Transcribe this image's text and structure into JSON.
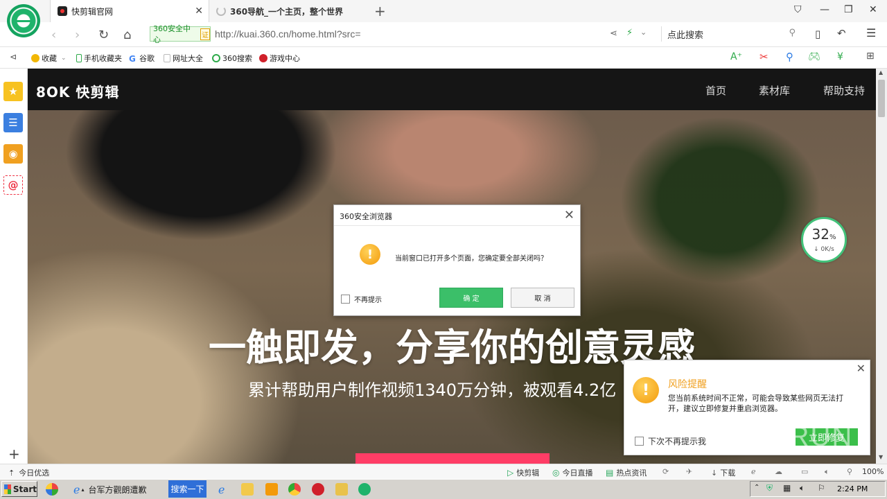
{
  "browser": {
    "active_tab": "快剪辑官网",
    "inactive_tab": "360导航_一个主页，整个世界",
    "safe_badge": "360安全中心",
    "safe_cert": "证",
    "url": "http://kuai.360.cn/home.html?src=",
    "search_placeholder": "点此搜索"
  },
  "bookmarks": [
    {
      "label": "收藏",
      "color": "#f2b705"
    },
    {
      "label": "手机收藏夹",
      "color": "#2eaa4a"
    },
    {
      "label": "谷歌",
      "color": "#4285f4"
    },
    {
      "label": "网址大全",
      "color": "#bbbbbb"
    },
    {
      "label": "360搜索",
      "color": "#2eaa4a"
    },
    {
      "label": "游戏中心",
      "color": "#d0202a"
    }
  ],
  "site": {
    "logo": "8OK 快剪辑",
    "nav": [
      "首页",
      "素材库",
      "帮助支持"
    ],
    "hero_title": "一触即发，分享你的创意灵感",
    "hero_subtitle": "累计帮助用户制作视频1340万分钟，被观看4.2亿"
  },
  "speed_widget": {
    "percent": "32",
    "unit": "%",
    "rate": "↓ 0K/s",
    "ring_color": "#42c27a"
  },
  "dialog": {
    "title": "360安全浏览器",
    "message": "当前窗口已打开多个页面，您确定要全部关闭吗？",
    "dont_remind": "不再提示",
    "ok": "确 定",
    "cancel": "取 消"
  },
  "risk_popup": {
    "title": "风险提醒",
    "body": "您当前系统时间不正常，可能会导致某些网页无法打开，建议立即修复并重启浏览器。",
    "dont_remind": "下次不再提示我",
    "fix_button": "立即修复"
  },
  "watermark": "ANY RUN",
  "statusbar": {
    "left": "今日优选",
    "items": [
      "快剪辑",
      "今日直播",
      "热点资讯",
      "下载"
    ],
    "zoom": "100%"
  },
  "taskbar": {
    "start": "Start",
    "app_title": "台军方觀朗遭歉",
    "search_button": "搜索一下",
    "clock": "2:24 PM"
  }
}
